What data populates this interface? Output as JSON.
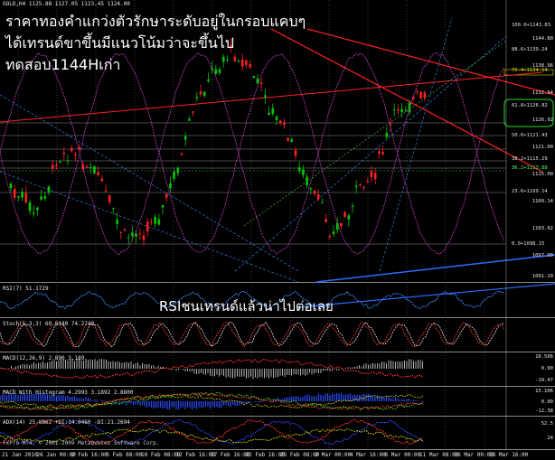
{
  "symbol_header": "GOLD,H4  1125.88 1127.05 1123.45 1124.00",
  "annotation": {
    "line1": "ราคาทองคำแกว่งตัวรักษาระดับอยู่ในกรอบแคบๆ",
    "line2": "ได้เทรนด์ขาขึ้นมีแนวโน้มว่าจะขึ้นไป",
    "line3": "ทดสอบ1144Hเก่า",
    "rsi_note": "RSIชนเทรนด์แล้วน่าไปต่อเลย"
  },
  "price_axis": [
    "1144.80",
    "1138.96",
    "1132.94",
    "1126.92",
    "1121.00",
    "1115.00",
    "1109.14",
    "1103.02",
    "1097.00",
    "1091.20"
  ],
  "fib_levels": [
    {
      "label": "100.0+1143.83",
      "color": "#e0e0e0"
    },
    {
      "label": "88.6+1139.24",
      "color": "#e0e0e0"
    },
    {
      "label": "76.4+1134.14",
      "color": "#d8d800"
    },
    {
      "label": "61.8+1126.82",
      "color": "#e0e0e0"
    },
    {
      "label": "50.0+1121.43",
      "color": "#e0e0e0"
    },
    {
      "label": "38.2+1115.29",
      "color": "#e0e0e0"
    },
    {
      "label": "36.2+1113.88",
      "color": "#55ff55"
    },
    {
      "label": "23.6+1109.14",
      "color": "#e0e0e0"
    },
    {
      "label": "0.0+1098.15",
      "color": "#e0e0e0"
    }
  ],
  "panes": {
    "rsi": {
      "label": "RSI(7) 51.1729"
    },
    "stoch": {
      "label": "Stoch(5,3,3) 69.5130 74.2749"
    },
    "macd": {
      "label": "MACD(12,26,9) 2.890 3.189",
      "axis": [
        "10.506",
        "0.00",
        "-10.47"
      ]
    },
    "macd_hist": {
      "label": "MACD With Histogram 4.2993 3.1892 2.8800",
      "axis": [
        "15.106",
        "0.00",
        "-12.38"
      ]
    },
    "adx": {
      "label": "ADX(14) 25.8862 +DI:14.0460 -DI:21.2694",
      "axis": [
        "52.5",
        "24"
      ]
    }
  },
  "copyright": "FxPro MT4, © 2001-2009 MetaQuotes Software Corp.",
  "dates": [
    "21 Jan 2010",
    "26 Jan 00:00",
    "2 Feb 16:00",
    "5 Feb 08:00",
    "10 Feb 08:00",
    "12 Feb 16:00",
    "17 Feb 16:00",
    "22 Feb 16:00",
    "25 Feb 08:00",
    "2 Mar 00:00",
    "4 Mar 16:00",
    "8 Mar 00:00",
    "11 Mar 08:00",
    "16 Mar 00:00",
    "18 Mar 16:00"
  ],
  "colors": {
    "bull": "#00c800",
    "bear": "#ff2020",
    "grid": "#5a5a5a",
    "trend_red": "#ff2020",
    "trend_blue": "#2a6cff",
    "rsi_line": "#3a8cff",
    "macd_signal": "#ff3030",
    "magenta": "#c040c0"
  }
}
